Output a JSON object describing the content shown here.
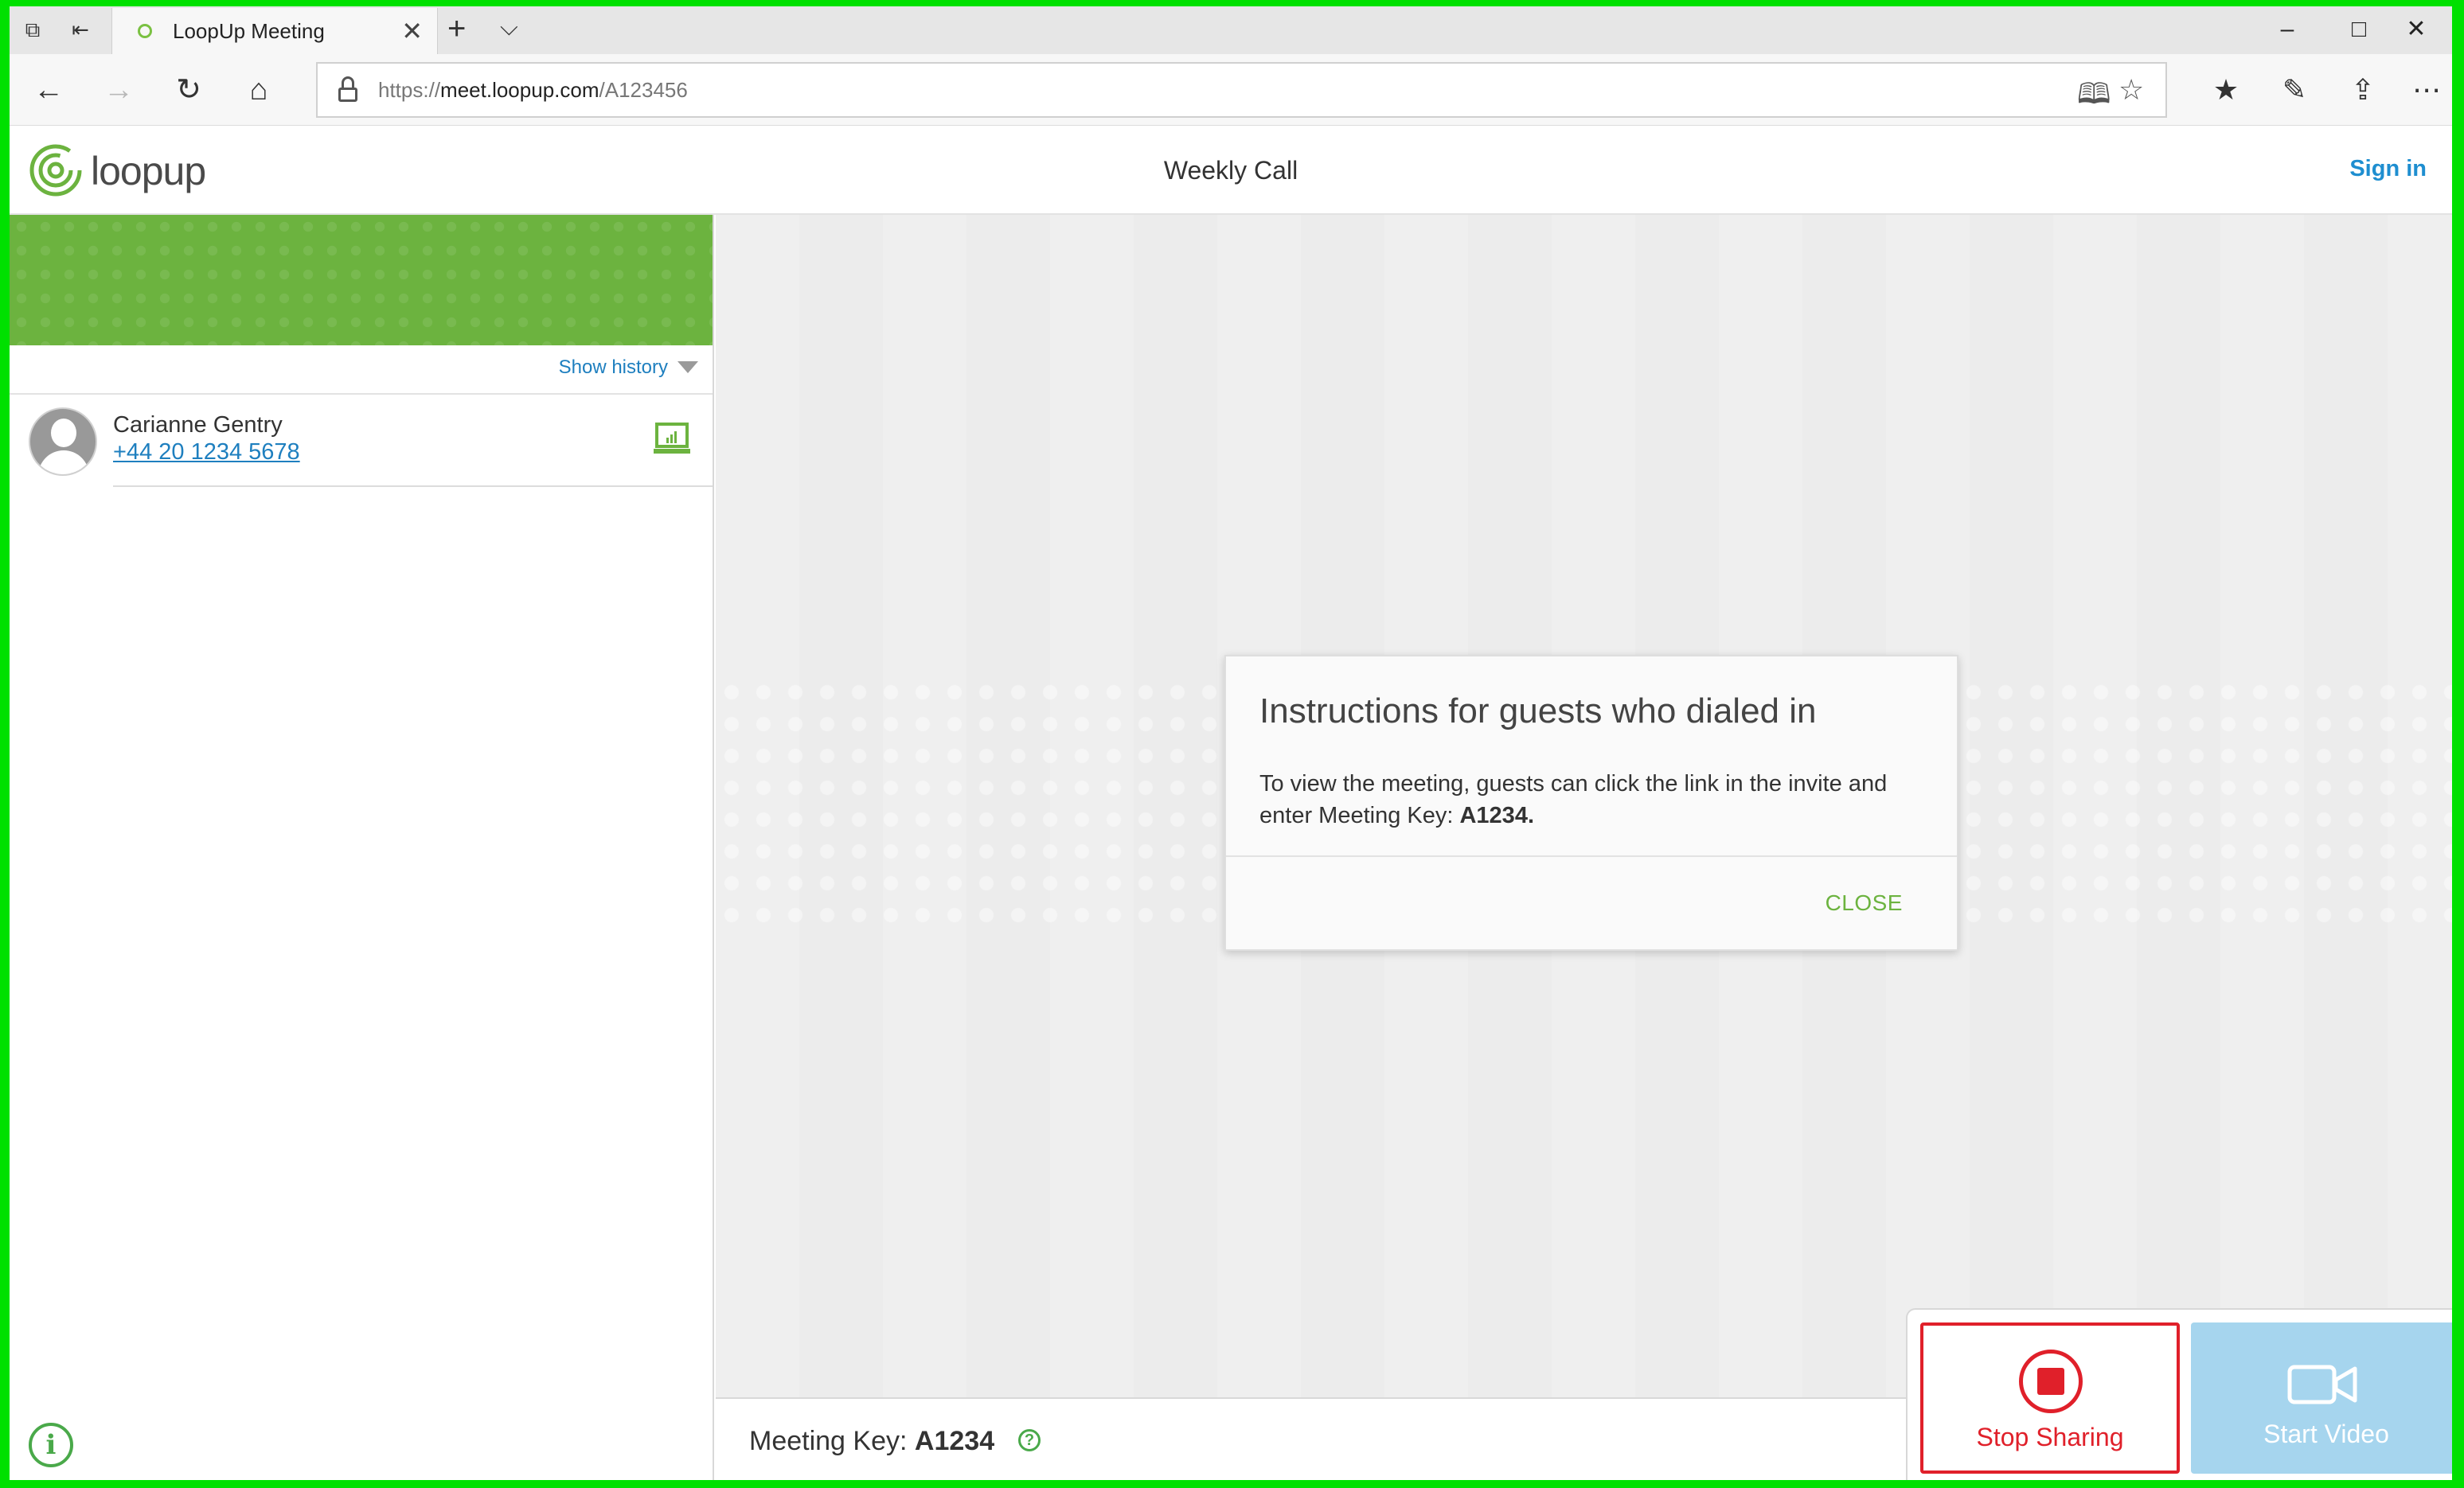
{
  "browser": {
    "tab_title": "LoopUp Meeting",
    "url_prefix": "https://",
    "url_host": "meet.loopup.com",
    "url_path": "/A123456"
  },
  "header": {
    "logo_text": "loopup",
    "meeting_title": "Weekly Call",
    "sign_in": "Sign in"
  },
  "sidebar": {
    "show_history": "Show history",
    "participants": [
      {
        "name": "Carianne Gentry",
        "phone": "+44 20 1234 5678"
      }
    ]
  },
  "modal": {
    "title": "Instructions for guests who dialed in",
    "body": "To view the meeting, guests can click the link in the invite and enter Meeting Key:",
    "key": "A1234.",
    "close": "CLOSE"
  },
  "footer": {
    "meeting_key_label": "Meeting Key:",
    "meeting_key_value": "A1234"
  },
  "actions": {
    "stop_sharing": "Stop Sharing",
    "start_video": "Start Video"
  },
  "colors": {
    "brand_green": "#6cb33f",
    "link_blue": "#1e7fbf",
    "stop_red": "#e0202a",
    "video_blue": "#a6d5ee"
  }
}
